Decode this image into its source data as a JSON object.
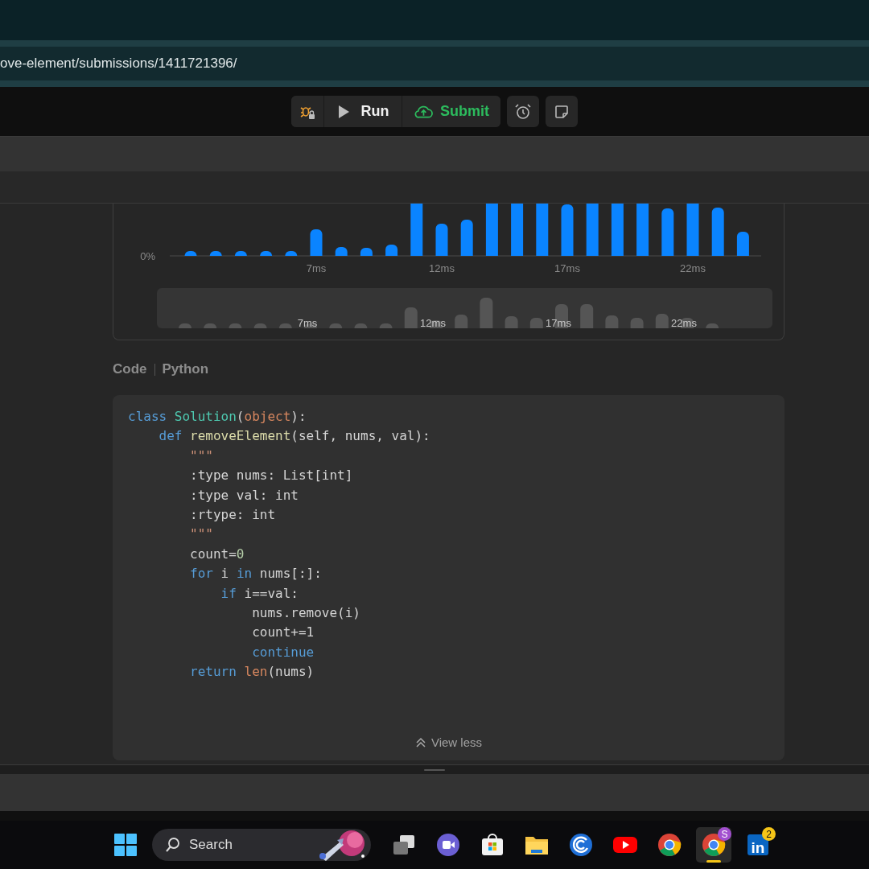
{
  "address_bar": {
    "url": "ove-element/submissions/1411721396/"
  },
  "toolbar": {
    "buttons": [
      {
        "kind": "debug"
      },
      {
        "kind": "run",
        "label": "Run"
      },
      {
        "kind": "submit",
        "label": "Submit"
      }
    ],
    "tools": [
      {
        "kind": "alarm"
      },
      {
        "kind": "note"
      }
    ]
  },
  "runtime_chart": {
    "y_labels": [
      "0%"
    ],
    "x_labels": [
      "7ms",
      "12ms",
      "17ms",
      "22ms"
    ],
    "minimap_labels": [
      "7ms",
      "12ms",
      "17ms",
      "22ms"
    ]
  },
  "code_header": {
    "label": "Code",
    "language": "Python"
  },
  "code_lines": [
    [
      {
        "kind": "keyword",
        "text": "class "
      },
      {
        "kind": "class",
        "text": "Solution"
      },
      {
        "kind": "plain",
        "text": "("
      },
      {
        "kind": "builtin",
        "text": "object"
      },
      {
        "kind": "plain",
        "text": "):"
      }
    ],
    [
      {
        "kind": "keyword",
        "text": "    def "
      },
      {
        "kind": "function",
        "text": "removeElement"
      },
      {
        "kind": "plain",
        "text": "(self, nums, val):"
      }
    ],
    [
      {
        "kind": "string",
        "text": "        \"\"\""
      }
    ],
    [
      {
        "kind": "plain",
        "text": "        :type nums: List[int]"
      }
    ],
    [
      {
        "kind": "plain",
        "text": "        :type val: int"
      }
    ],
    [
      {
        "kind": "plain",
        "text": "        :rtype: int"
      }
    ],
    [
      {
        "kind": "string",
        "text": "        \"\"\""
      }
    ],
    [
      {
        "kind": "plain",
        "text": "        count="
      },
      {
        "kind": "number",
        "text": "0"
      }
    ],
    [
      {
        "kind": "keyword",
        "text": "        for"
      },
      {
        "kind": "plain",
        "text": " i "
      },
      {
        "kind": "keyword",
        "text": "in"
      },
      {
        "kind": "plain",
        "text": " nums[:]:"
      }
    ],
    [
      {
        "kind": "keyword",
        "text": "            if"
      },
      {
        "kind": "plain",
        "text": " i==val:"
      }
    ],
    [
      {
        "kind": "plain",
        "text": "                nums.remove(i)"
      }
    ],
    [
      {
        "kind": "plain",
        "text": "                count+=1"
      }
    ],
    [
      {
        "kind": "keyword",
        "text": "                continue"
      }
    ],
    [
      {
        "kind": "keyword",
        "text": "        return "
      },
      {
        "kind": "builtin",
        "text": "len"
      },
      {
        "kind": "plain",
        "text": "(nums)"
      }
    ]
  ],
  "view_toggle": {
    "label": "View less"
  },
  "taskbar": {
    "search": {
      "placeholder": "Search"
    },
    "apps": [
      {
        "kind": "taskview",
        "running": false
      },
      {
        "kind": "meet",
        "running": false
      },
      {
        "kind": "store",
        "running": false
      },
      {
        "kind": "files",
        "running": false
      },
      {
        "kind": "swirl",
        "running": false
      },
      {
        "kind": "youtube",
        "running": false
      },
      {
        "kind": "chrome",
        "running": false
      },
      {
        "kind": "chrome",
        "badge": "S",
        "running": true
      },
      {
        "kind": "linkedin",
        "label": "in",
        "badge": "2",
        "running": false
      }
    ]
  }
}
